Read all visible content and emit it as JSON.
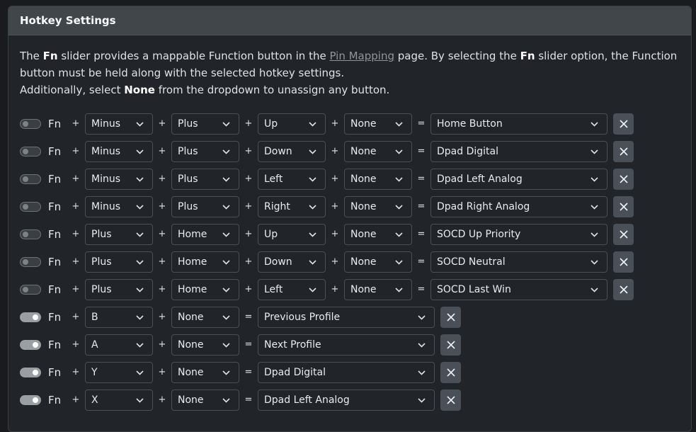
{
  "header": {
    "title": "Hotkey Settings"
  },
  "description": {
    "p1_a": "The ",
    "fn": "Fn",
    "p1_b": " slider provides a mappable Function button in the ",
    "link": "Pin Mapping",
    "p1_c": " page. By selecting the ",
    "p1_d": " slider option, the Function button must be held along with the selected hotkey settings.",
    "p2_a": "Additionally, select ",
    "none": "None",
    "p2_b": " from the dropdown to unassign any button."
  },
  "labels": {
    "fn": "Fn",
    "plus": "+",
    "equals": "=",
    "chevron": "⌄",
    "close": "✕"
  },
  "rows": [
    {
      "enabled": false,
      "buttons": [
        "Minus",
        "Plus",
        "Up",
        "None"
      ],
      "action": "Home Button"
    },
    {
      "enabled": false,
      "buttons": [
        "Minus",
        "Plus",
        "Down",
        "None"
      ],
      "action": "Dpad Digital"
    },
    {
      "enabled": false,
      "buttons": [
        "Minus",
        "Plus",
        "Left",
        "None"
      ],
      "action": "Dpad Left Analog"
    },
    {
      "enabled": false,
      "buttons": [
        "Minus",
        "Plus",
        "Right",
        "None"
      ],
      "action": "Dpad Right Analog"
    },
    {
      "enabled": false,
      "buttons": [
        "Plus",
        "Home",
        "Up",
        "None"
      ],
      "action": "SOCD Up Priority"
    },
    {
      "enabled": false,
      "buttons": [
        "Plus",
        "Home",
        "Down",
        "None"
      ],
      "action": "SOCD Neutral"
    },
    {
      "enabled": false,
      "buttons": [
        "Plus",
        "Home",
        "Left",
        "None"
      ],
      "action": "SOCD Last Win"
    },
    {
      "enabled": true,
      "buttons": [
        "B",
        "None"
      ],
      "action": "Previous Profile"
    },
    {
      "enabled": true,
      "buttons": [
        "A",
        "None"
      ],
      "action": "Next Profile"
    },
    {
      "enabled": true,
      "buttons": [
        "Y",
        "None"
      ],
      "action": "Dpad Digital"
    },
    {
      "enabled": true,
      "buttons": [
        "X",
        "None"
      ],
      "action": "Dpad Left Analog"
    }
  ]
}
